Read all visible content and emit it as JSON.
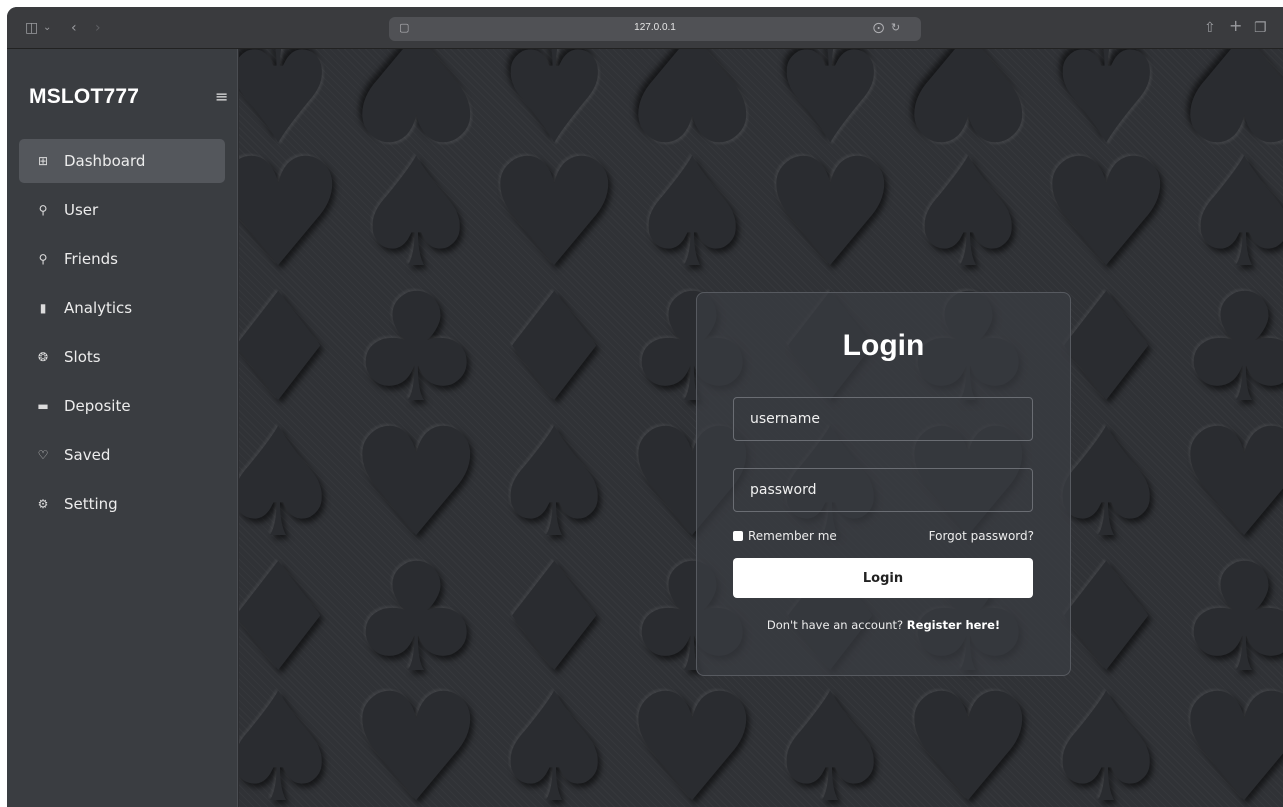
{
  "browser": {
    "url": "127.0.0.1",
    "icons": {
      "sidebar_toggle": "sidebar-icon",
      "back": "chevron-left-icon",
      "forward": "chevron-right-icon",
      "share": "share-icon",
      "new_tab": "plus-icon",
      "tabs": "tabs-icon"
    }
  },
  "sidebar": {
    "brand": "MSLOT777",
    "items": [
      {
        "label": "Dashboard",
        "icon": "grid-icon",
        "active": true
      },
      {
        "label": "User",
        "icon": "user-icon",
        "active": false
      },
      {
        "label": "Friends",
        "icon": "users-icon",
        "active": false
      },
      {
        "label": "Analytics",
        "icon": "bar-chart-icon",
        "active": false
      },
      {
        "label": "Slots",
        "icon": "slots-icon",
        "active": false
      },
      {
        "label": "Deposite",
        "icon": "card-icon",
        "active": false
      },
      {
        "label": "Saved",
        "icon": "heart-icon",
        "active": false
      },
      {
        "label": "Setting",
        "icon": "gear-icon",
        "active": false
      }
    ]
  },
  "login": {
    "title": "Login",
    "username_placeholder": "username",
    "password_placeholder": "password",
    "remember_label": "Remember me",
    "forgot_label": "Forgot password?",
    "button_label": "Login",
    "signup_prompt": "Don't have an account?",
    "signup_link": "Register here!"
  },
  "colors": {
    "background": "#303236",
    "sidebar": "#3a3d41",
    "active_item": "#54575c",
    "button": "#ffffff"
  }
}
